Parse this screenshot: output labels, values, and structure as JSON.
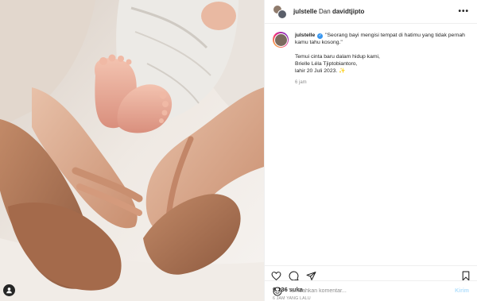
{
  "colors": {
    "accent": "#0095f6",
    "verified": "#3897f0",
    "muted": "#8e8e8e"
  },
  "header": {
    "author": "julstelle",
    "separator": "Dan",
    "coauthor": "davidtjipto",
    "more_label": "•••"
  },
  "caption": {
    "username": "julstelle",
    "quote": "\"Seorang bayi mengisi tempat di hatimu yang tidak pernah kamu tahu kosong.\"",
    "line1": "Temui cinta baru dalam hidup kami,",
    "line2": "Brielle Léla Tjiptobiantoro,",
    "line3": "lahir 20 Juli 2023. ✨",
    "time": "6 jam"
  },
  "actions": {
    "like_icon": "heart-icon",
    "comment_icon": "comment-icon",
    "share_icon": "send-icon",
    "save_icon": "bookmark-icon"
  },
  "likes_text": "9.136 suka",
  "post_time": "6 JAM YANG LALU",
  "comment_box": {
    "placeholder": "Tambahkan komentar...",
    "post_label": "Kirim"
  },
  "media": {
    "tag_icon": "user-tag-icon"
  }
}
